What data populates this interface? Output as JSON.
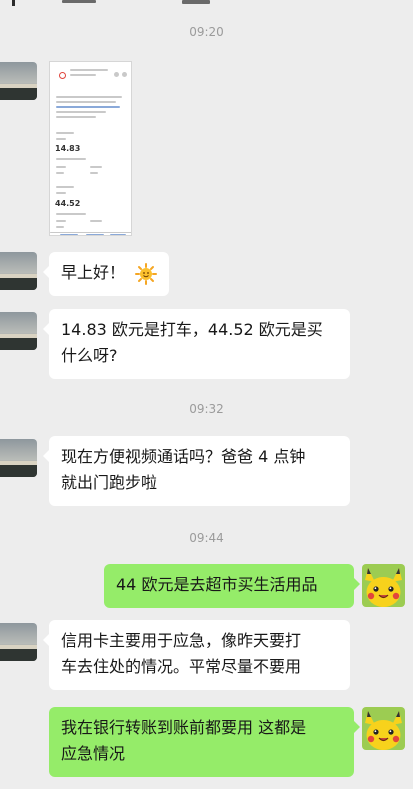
{
  "timestamps": [
    "09:20",
    "09:32",
    "09:44"
  ],
  "image_message": {
    "amount_1": "14.83",
    "amount_2": "44.52"
  },
  "messages": [
    {
      "side": "left",
      "text": "早上好！"
    },
    {
      "side": "left",
      "lines": [
        "14.83 欧元是打车，44.52 欧元是买",
        "什么呀?"
      ]
    },
    {
      "side": "left",
      "lines": [
        "现在方便视频通话吗？爸爸 4 点钟",
        "就出门跑步啦"
      ]
    },
    {
      "side": "right",
      "text": "44 欧元是去超市买生活用品"
    },
    {
      "side": "left",
      "lines": [
        "信用卡主要用于应急，像昨天要打",
        "车去住处的情况。平常尽量不要用"
      ]
    },
    {
      "side": "right",
      "lines": [
        "我在银行转账到账前都要用 这都是",
        "应急情况"
      ]
    }
  ],
  "icons": {
    "sun_emoji": "sun-emoji-icon",
    "avatar_left": "landscape-avatar",
    "avatar_right": "pikachu-avatar"
  },
  "colors": {
    "background": "#ededed",
    "incoming_bubble": "#ffffff",
    "outgoing_bubble": "#95ec69",
    "timestamp": "#9b9b9b"
  }
}
